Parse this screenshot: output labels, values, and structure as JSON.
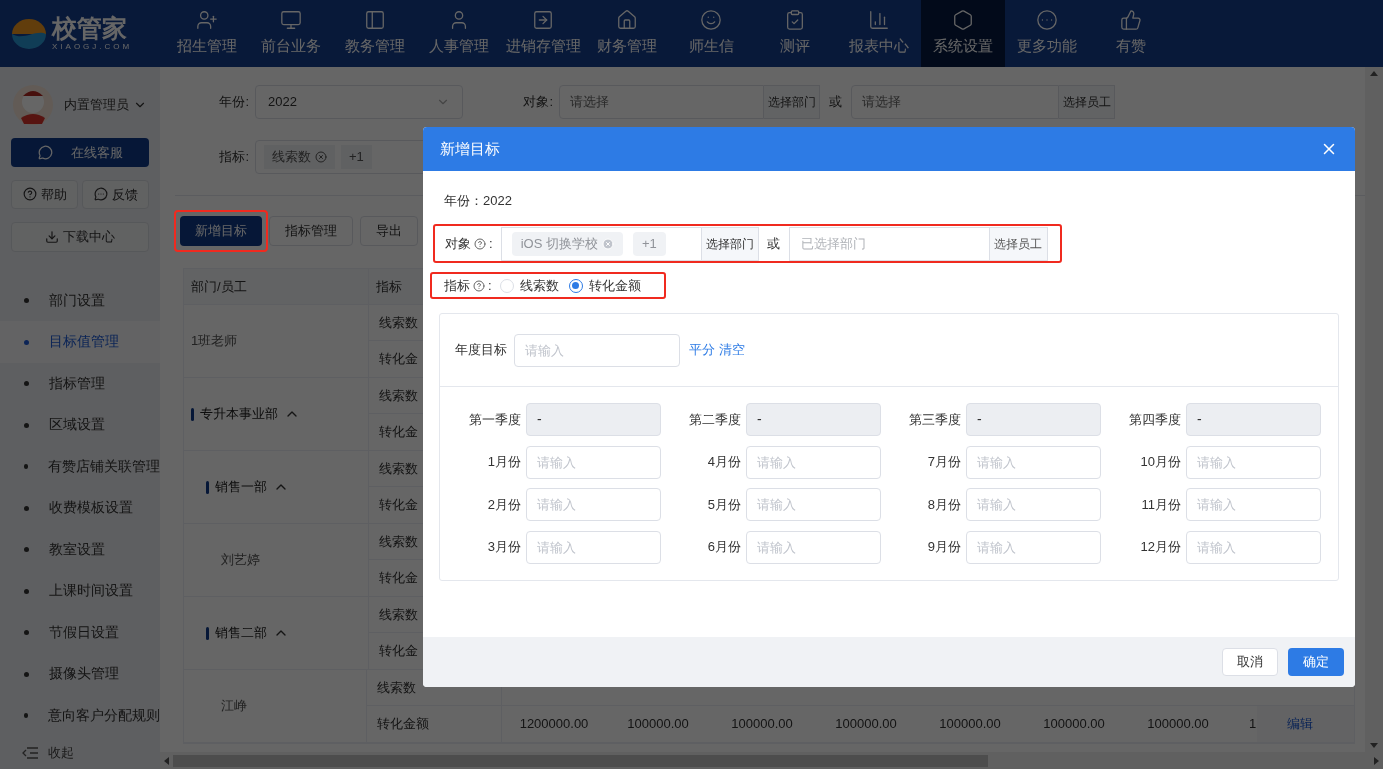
{
  "brand": {
    "name": "校管家",
    "domain": "XIAOGJ.COM"
  },
  "nav": [
    {
      "label": "招生管理",
      "selected": false
    },
    {
      "label": "前台业务",
      "selected": false
    },
    {
      "label": "教务管理",
      "selected": false
    },
    {
      "label": "人事管理",
      "selected": false
    },
    {
      "label": "进销存管理",
      "selected": false
    },
    {
      "label": "财务管理",
      "selected": false
    },
    {
      "label": "师生信",
      "selected": false
    },
    {
      "label": "测评",
      "selected": false
    },
    {
      "label": "报表中心",
      "selected": false
    },
    {
      "label": "系统设置",
      "selected": true
    },
    {
      "label": "更多功能",
      "selected": false
    },
    {
      "label": "有赞",
      "selected": false
    }
  ],
  "sidebar": {
    "user": "内置管理员",
    "support": "在线客服",
    "help": "帮助",
    "feedback": "反馈",
    "download": "下载中心",
    "items": [
      {
        "label": "部门设置",
        "selected": false
      },
      {
        "label": "目标值管理",
        "selected": true
      },
      {
        "label": "指标管理",
        "selected": false
      },
      {
        "label": "区域设置",
        "selected": false
      },
      {
        "label": "有赞店铺关联管理",
        "selected": false
      },
      {
        "label": "收费模板设置",
        "selected": false
      },
      {
        "label": "教室设置",
        "selected": false
      },
      {
        "label": "上课时间设置",
        "selected": false
      },
      {
        "label": "节假日设置",
        "selected": false
      },
      {
        "label": "摄像头管理",
        "selected": false
      },
      {
        "label": "意向客户分配规则",
        "selected": false
      }
    ],
    "collapse": "收起"
  },
  "filters": {
    "year_label": "年份:",
    "year": "2022",
    "target_label": "对象:",
    "target_placeholder": "请选择",
    "dept_button": "选择部门",
    "or": "或",
    "staff_placeholder": "请选择",
    "staff_button": "选择员工",
    "metric_label": "指标:",
    "metric_tag": "线索数",
    "metric_more": "+1"
  },
  "toolbar": [
    {
      "label": "新增目标",
      "kind": "primary",
      "highlighted": true
    },
    {
      "label": "指标管理",
      "kind": "default",
      "highlighted": false
    },
    {
      "label": "导出",
      "kind": "default",
      "highlighted": false
    }
  ],
  "table": {
    "columns": [
      "部门/员工",
      "指标"
    ],
    "rows": [
      {
        "name": "1班老师",
        "kind": "staff",
        "metrics": [
          {
            "label": "线索数"
          },
          {
            "label": "转化金"
          }
        ]
      },
      {
        "name": "专升本事业部",
        "kind": "dept",
        "expanded": true,
        "metrics": [
          {
            "label": "线索数"
          },
          {
            "label": "转化金"
          }
        ],
        "children": [
          {
            "name": "销售一部",
            "kind": "dept",
            "expanded": true,
            "metrics": [
              {
                "label": "线索数"
              },
              {
                "label": "转化金"
              }
            ],
            "children": [
              {
                "name": "刘艺婷",
                "kind": "staff",
                "metrics": [
                  {
                    "label": "线索数"
                  },
                  {
                    "label": "转化金"
                  }
                ]
              }
            ]
          },
          {
            "name": "销售二部",
            "kind": "dept",
            "expanded": true,
            "metrics": [
              {
                "label": "线索数"
              },
              {
                "label": "转化金"
              }
            ],
            "children": [
              {
                "name": "江峥",
                "kind": "staff",
                "metrics": [
                  {
                    "label": "线索数"
                  },
                  {
                    "label": "转化金额",
                    "values": [
                      "1200000.00",
                      "100000.00",
                      "100000.00",
                      "100000.00",
                      "100000.00",
                      "100000.00",
                      "100000.00",
                      "1"
                    ],
                    "action": "编辑"
                  }
                ]
              }
            ]
          }
        ]
      }
    ]
  },
  "dialog": {
    "title": "新增目标",
    "year": "年份：2022",
    "target": {
      "label": "对象",
      "colon": ":",
      "highlighted": true,
      "tags": [
        {
          "label": "iOS 切换学校",
          "removable": true
        },
        {
          "label": "+1",
          "removable": false
        }
      ],
      "dept_button": "选择部门",
      "or": "或",
      "staff_placeholder": "已选择部门",
      "staff_button": "选择员工"
    },
    "metric": {
      "label": "指标",
      "colon": ":",
      "highlighted": true,
      "options": [
        {
          "label": "线索数",
          "selected": false
        },
        {
          "label": "转化金额",
          "selected": true
        }
      ]
    },
    "annual": {
      "label": "年度目标",
      "placeholder": "请输入",
      "links": [
        "平分",
        "清空"
      ]
    },
    "quarters": [
      {
        "label": "第一季度",
        "placeholder": "-",
        "disabled": true,
        "months": [
          {
            "label": "1月份",
            "placeholder": "请输入"
          },
          {
            "label": "2月份",
            "placeholder": "请输入"
          },
          {
            "label": "3月份",
            "placeholder": "请输入"
          }
        ]
      },
      {
        "label": "第二季度",
        "placeholder": "-",
        "disabled": true,
        "months": [
          {
            "label": "4月份",
            "placeholder": "请输入"
          },
          {
            "label": "5月份",
            "placeholder": "请输入"
          },
          {
            "label": "6月份",
            "placeholder": "请输入"
          }
        ]
      },
      {
        "label": "第三季度",
        "placeholder": "-",
        "disabled": true,
        "months": [
          {
            "label": "7月份",
            "placeholder": "请输入"
          },
          {
            "label": "8月份",
            "placeholder": "请输入"
          },
          {
            "label": "9月份",
            "placeholder": "请输入"
          }
        ]
      },
      {
        "label": "第四季度",
        "placeholder": "-",
        "disabled": true,
        "months": [
          {
            "label": "10月份",
            "placeholder": "请输入"
          },
          {
            "label": "11月份",
            "placeholder": "请输入"
          },
          {
            "label": "12月份",
            "placeholder": "请输入"
          }
        ]
      }
    ],
    "cancel": "取消",
    "confirm": "确定"
  }
}
